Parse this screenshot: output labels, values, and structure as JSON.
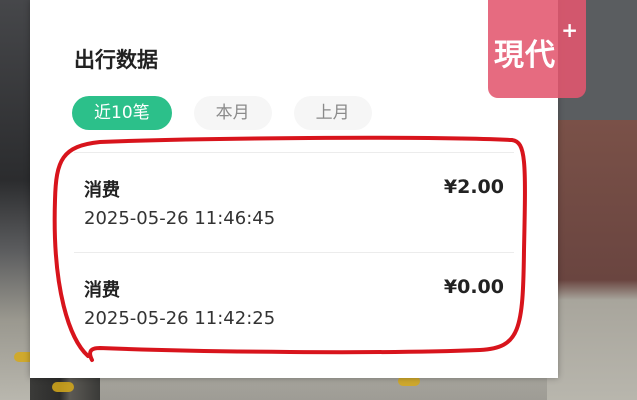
{
  "title": "出行数据",
  "tabs": [
    {
      "label": "近10笔",
      "active": true
    },
    {
      "label": "本月",
      "active": false
    },
    {
      "label": "上月",
      "active": false
    }
  ],
  "records": [
    {
      "type": "消费",
      "amount": "¥2.00",
      "time": "2025-05-26 11:46:45"
    },
    {
      "type": "消费",
      "amount": "¥0.00",
      "time": "2025-05-26 11:42:25"
    }
  ],
  "watermark": {
    "text": "現代",
    "plus": "+"
  },
  "colors": {
    "accent": "#2cc08a",
    "annotation": "#d8141c",
    "watermark": "#e2576e"
  }
}
